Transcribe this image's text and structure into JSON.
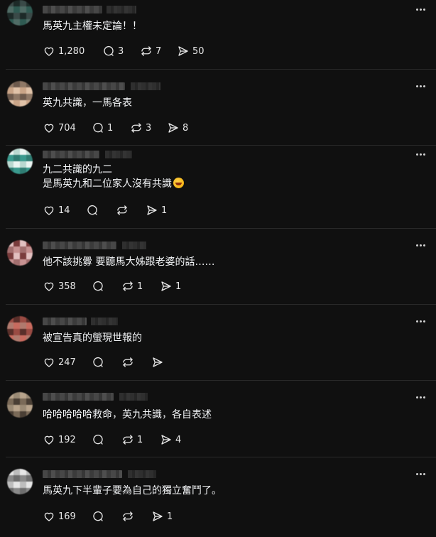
{
  "posts": [
    {
      "text": "馬英九主權未定論！！",
      "likes": "1,280",
      "replies": "3",
      "reposts": "7",
      "shares": "50",
      "avatar_colors": [
        "#3a4a48",
        "#2f5a52",
        "#1d2a28",
        "#4f6b65"
      ]
    },
    {
      "text": "英九共識，一馬各表",
      "likes": "704",
      "replies": "1",
      "reposts": "3",
      "shares": "8",
      "avatar_colors": [
        "#c9a487",
        "#8f7866",
        "#e0c2a8",
        "#6d5a4d"
      ]
    },
    {
      "text": "九二共識的九二",
      "text2": "是馬英九和二位家人沒有共識",
      "likes": "14",
      "replies": "",
      "reposts": "",
      "shares": "1",
      "avatar_colors": [
        "#b9d8d0",
        "#3a9a8e",
        "#eaf4f1",
        "#2f7d73"
      ]
    },
    {
      "text": "他不該挑釁 要聽馬大姊跟老婆的話……",
      "likes": "358",
      "replies": "",
      "reposts": "1",
      "shares": "1",
      "avatar_colors": [
        "#c79292",
        "#7a3c3c",
        "#a26e6e",
        "#e2c0c0"
      ]
    },
    {
      "text": "被宣告真的螢現世報的",
      "likes": "247",
      "replies": "",
      "reposts": "",
      "shares": "",
      "avatar_colors": [
        "#9a4b43",
        "#c86b5f",
        "#5a2f2a",
        "#b07a6e"
      ]
    },
    {
      "text": "哈哈哈哈哈救命，英九共識，各自表述",
      "likes": "192",
      "replies": "",
      "reposts": "1",
      "shares": "4",
      "avatar_colors": [
        "#7a6a58",
        "#b8a48c",
        "#4a3f35",
        "#9a8a75"
      ]
    },
    {
      "text": "馬英九下半輩子要為自己的獨立奮鬥了。",
      "likes": "169",
      "replies": "",
      "reposts": "",
      "shares": "1",
      "avatar_colors": [
        "#bdbdbd",
        "#8a8a8a",
        "#e6e6e6",
        "#6e6e6e"
      ]
    }
  ],
  "icons": {
    "like": "heart-icon",
    "reply": "comment-icon",
    "repost": "repost-icon",
    "share": "share-icon",
    "more": "more-icon"
  }
}
